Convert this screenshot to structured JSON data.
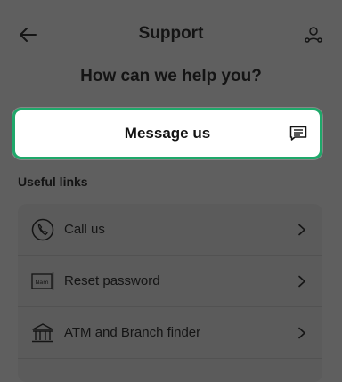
{
  "header": {
    "title": "Support",
    "back_icon": "arrow-left-icon",
    "profile_icon": "person-network-icon"
  },
  "main": {
    "heading": "How can we help you?",
    "message_button": {
      "label": "Message us",
      "icon": "chat-message-icon"
    },
    "useful_links": {
      "label": "Useful links",
      "items": [
        {
          "label": "Call us",
          "icon": "phone-icon"
        },
        {
          "label": "Reset password",
          "icon": "name-card-icon",
          "icon_text": "Nam"
        },
        {
          "label": "ATM and Branch finder",
          "icon": "bank-building-icon"
        }
      ]
    }
  },
  "colors": {
    "overlay_background": "#5f5f5f",
    "accent_border": "#1fa86a",
    "text": "#141414"
  }
}
